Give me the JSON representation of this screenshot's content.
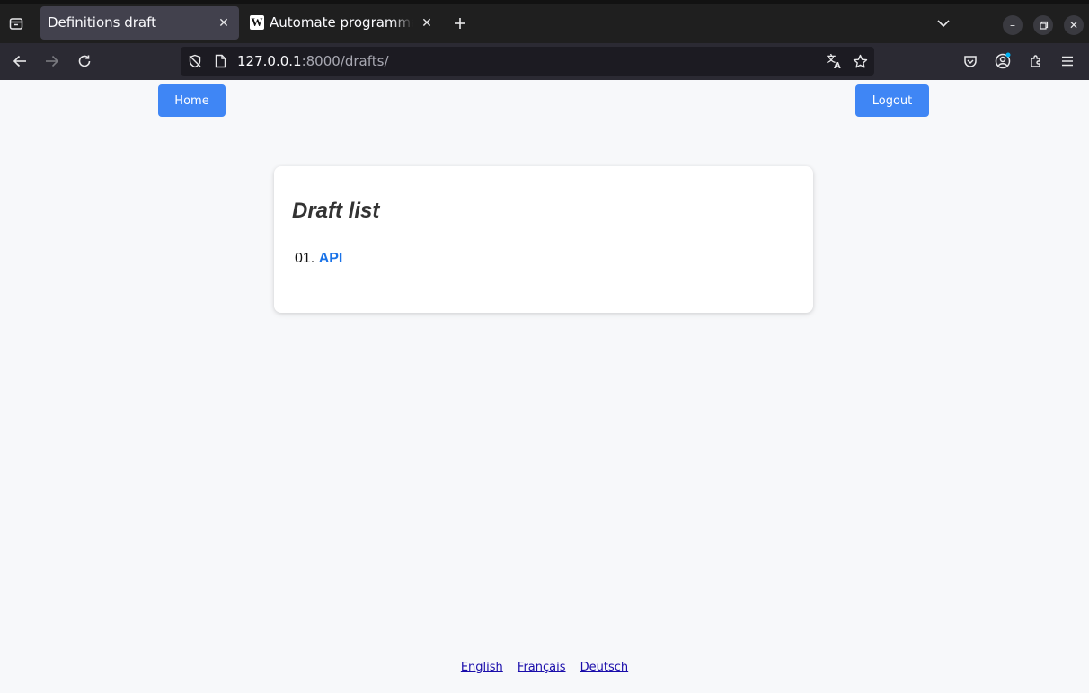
{
  "browser": {
    "tabs": [
      {
        "title": "Definitions draft",
        "active": true
      },
      {
        "title": "Automate programmable",
        "active": false,
        "favicon": "W"
      }
    ],
    "url": {
      "host": "127.0.0.1",
      "rest": ":8000/drafts/"
    },
    "icons": [
      "tab-overview-icon",
      "close-icon",
      "new-tab-icon",
      "tab-list-chevron-icon",
      "minimize-icon",
      "restore-icon",
      "window-close-icon",
      "back-icon",
      "forward-icon",
      "reload-icon",
      "tracking-shield-icon",
      "page-icon",
      "translate-icon",
      "bookmark-star-icon",
      "pocket-icon",
      "account-icon",
      "extensions-icon",
      "menu-icon"
    ]
  },
  "nav": {
    "home_label": "Home",
    "logout_label": "Logout"
  },
  "content": {
    "title": "Draft list",
    "items": [
      {
        "number": "01.",
        "label": "API"
      }
    ]
  },
  "footer": {
    "languages": [
      "English",
      "Français",
      "Deutsch"
    ]
  },
  "colors": {
    "primary_button": "#3f86f5",
    "link": "#1a73e8",
    "footer_link": "#1a0dab",
    "page_bg": "#f7f8fa"
  }
}
